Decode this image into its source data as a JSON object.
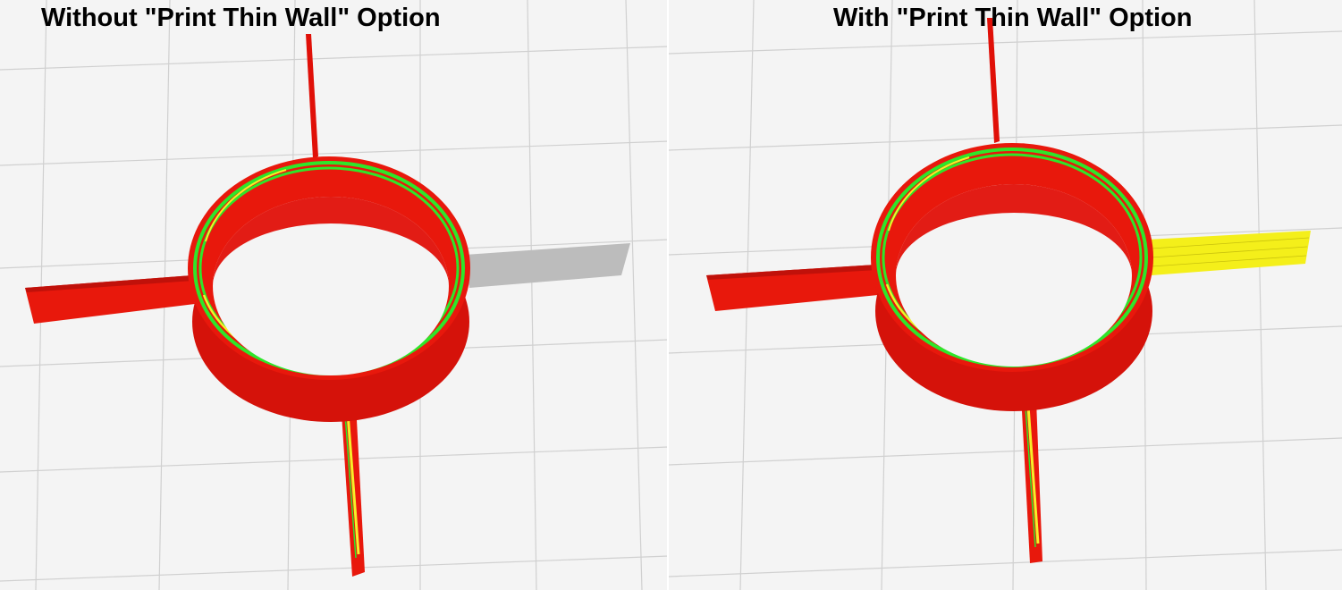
{
  "panels": [
    {
      "title": "Without \"Print Thin Wall\" Option",
      "thin_wall_color": "#bcbcbc"
    },
    {
      "title": "With \"Print Thin Wall\" Option",
      "thin_wall_color": "#f4ef1a"
    }
  ],
  "colors": {
    "outer_wall": "#e8180c",
    "outer_wall_dark": "#b80e06",
    "inner_wall": "#2ee62a",
    "infill_line": "#f7ee28",
    "grid_line": "#d0d0d0",
    "build_plate": "#f4f4f4"
  }
}
